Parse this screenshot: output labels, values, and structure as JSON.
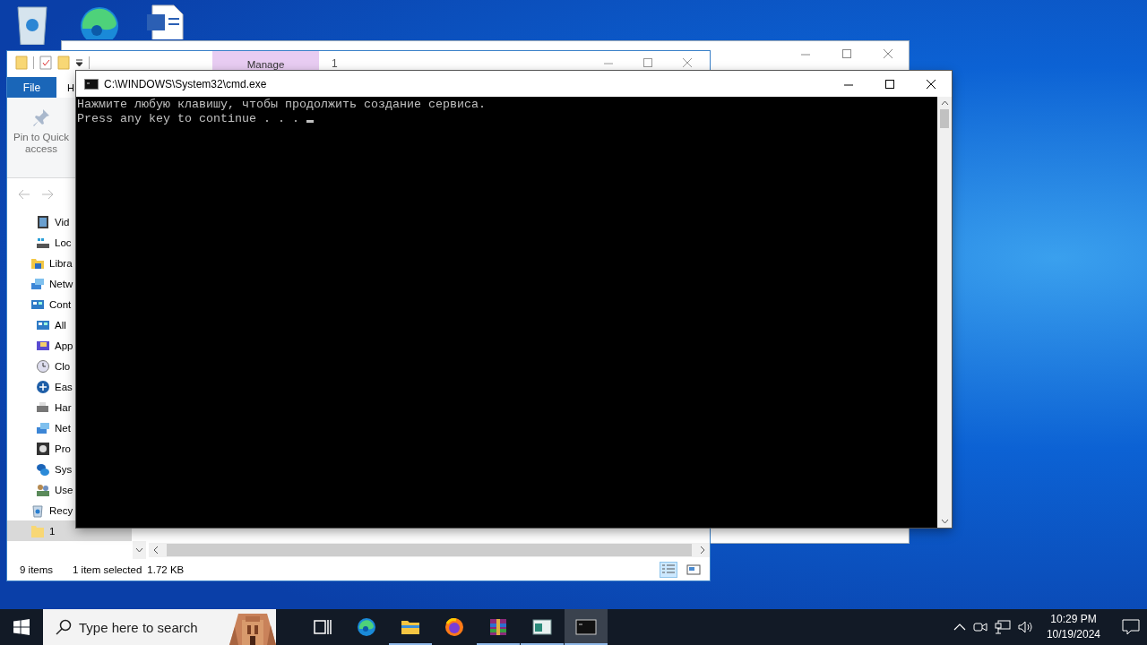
{
  "explorer": {
    "contextual_tab": "Manage",
    "title": "1",
    "ribbon_tabs": [
      {
        "label": "File",
        "kind": "backstage"
      },
      {
        "label": "H",
        "kind": "tab"
      }
    ],
    "ribbon_buttons": [
      {
        "label": "Pin to Quick access",
        "disabled": true
      }
    ],
    "nav_tree": [
      {
        "children": [
          {
            "label": "Vid",
            "kind": "video",
            "selected": false
          },
          {
            "label": "Loc",
            "kind": "drive",
            "selected": false
          }
        ]
      },
      {
        "label": "Libra",
        "kind": "library",
        "selected": false
      },
      {
        "label": "Netw",
        "kind": "network",
        "selected": false
      },
      {
        "label": "Cont",
        "kind": "control-panel",
        "selected": false,
        "children": [
          {
            "label": "All",
            "kind": "control-panel",
            "selected": false
          },
          {
            "label": "App",
            "kind": "apps",
            "selected": false
          },
          {
            "label": "Clo",
            "kind": "clock",
            "selected": false
          },
          {
            "label": "Eas",
            "kind": "ease",
            "selected": false
          },
          {
            "label": "Har",
            "kind": "hardware",
            "selected": false
          },
          {
            "label": "Net",
            "kind": "network",
            "selected": false
          },
          {
            "label": "Pro",
            "kind": "programs",
            "selected": false
          },
          {
            "label": "Sys",
            "kind": "system",
            "selected": false
          },
          {
            "label": "Use",
            "kind": "users",
            "selected": false
          }
        ]
      },
      {
        "label": "Recy",
        "kind": "recycle",
        "selected": false
      },
      {
        "label": "1",
        "kind": "folder",
        "selected": true
      }
    ],
    "status": {
      "items": "9 items",
      "selection": "1 item selected",
      "size": "1.72 KB"
    },
    "views": [
      {
        "kind": "details",
        "selected": true
      },
      {
        "kind": "tiles",
        "selected": false
      }
    ]
  },
  "cmd": {
    "title": "C:\\WINDOWS\\System32\\cmd.exe",
    "lines": [
      "Нажмите любую клавишу, чтобы продолжить создание сервиса.",
      "Press any key to continue . . . "
    ]
  },
  "taskbar": {
    "search_placeholder": "Type here to search",
    "apps": [
      {
        "kind": "task-view",
        "running": false,
        "active": false
      },
      {
        "kind": "edge",
        "running": false,
        "active": false
      },
      {
        "kind": "explorer",
        "running": true,
        "active": false
      },
      {
        "kind": "firefox",
        "running": false,
        "active": false
      },
      {
        "kind": "archiver",
        "running": true,
        "active": false
      },
      {
        "kind": "window-app",
        "running": true,
        "active": false
      },
      {
        "kind": "console",
        "running": true,
        "active": true
      }
    ],
    "time": "10:29 PM",
    "date": "10/19/2024"
  }
}
